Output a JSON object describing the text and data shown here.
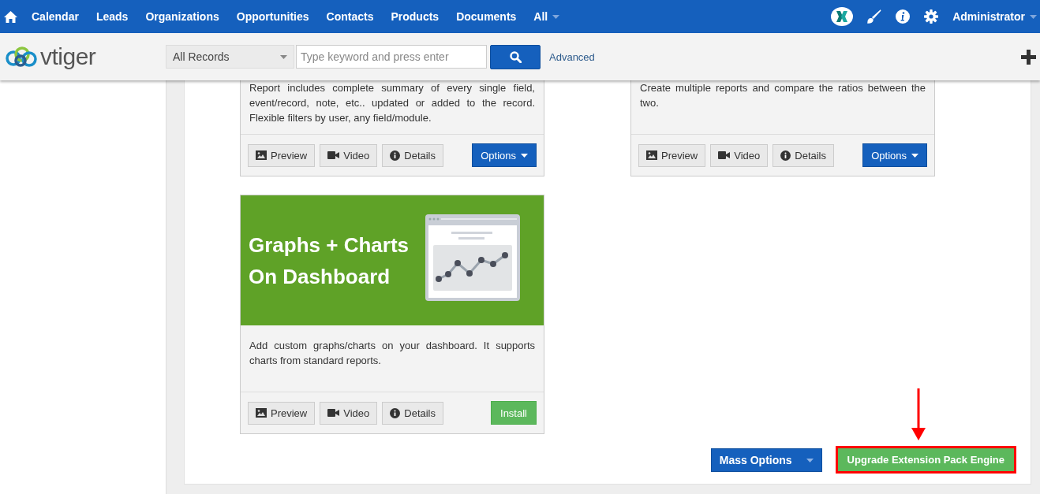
{
  "nav": {
    "items": [
      "Calendar",
      "Leads",
      "Organizations",
      "Opportunities",
      "Contacts",
      "Products",
      "Documents"
    ],
    "all_label": "All",
    "user": "Administrator"
  },
  "brand": {
    "logo": "vtiger"
  },
  "search": {
    "filter": "All Records",
    "placeholder": "Type keyword and press enter",
    "advanced": "Advanced"
  },
  "cards": [
    {
      "kind": "plain",
      "description": "Report includes complete summary of every single field, event/record, note, etc.. updated or added to the record. Flexible filters by user, any field/module.",
      "buttons": [
        {
          "kind": "preview",
          "label": "Preview"
        },
        {
          "kind": "video",
          "label": "Video"
        },
        {
          "kind": "details",
          "label": "Details"
        }
      ],
      "action": {
        "kind": "options",
        "label": "Options"
      }
    },
    {
      "kind": "plain",
      "description": "Create multiple reports and compare the ratios between the two.",
      "buttons": [
        {
          "kind": "preview",
          "label": "Preview"
        },
        {
          "kind": "video",
          "label": "Video"
        },
        {
          "kind": "details",
          "label": "Details"
        }
      ],
      "action": {
        "kind": "options",
        "label": "Options"
      }
    },
    {
      "kind": "banner",
      "banner_title": [
        "Graphs + Charts",
        "On Dashboard"
      ],
      "description": "Add custom graphs/charts on your dashboard. It supports charts from standard reports.",
      "buttons": [
        {
          "kind": "preview",
          "label": "Preview"
        },
        {
          "kind": "video",
          "label": "Video"
        },
        {
          "kind": "details",
          "label": "Details"
        }
      ],
      "action": {
        "kind": "install",
        "label": "Install"
      }
    }
  ],
  "footer": {
    "mass_options": "Mass Options",
    "upgrade": "Upgrade Extension Pack Engine",
    "highlighted": true
  }
}
